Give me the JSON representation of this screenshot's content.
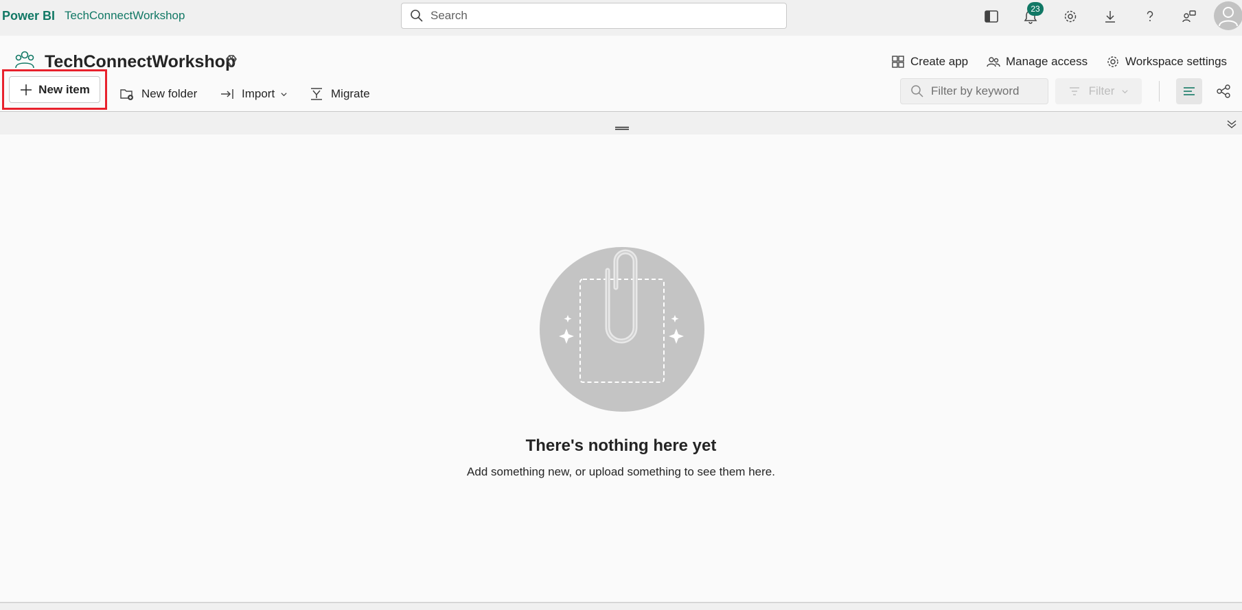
{
  "topbar": {
    "brand": "Power BI",
    "workspace_link": "TechConnectWorkshop",
    "search_placeholder": "Search",
    "notification_count": "23",
    "icons": [
      "panel-icon",
      "bell-icon",
      "gear-icon",
      "download-icon",
      "help-icon",
      "share-feedback-icon",
      "avatar-icon"
    ]
  },
  "workspace": {
    "title": "TechConnectWorkshop",
    "premium_icon": "diamond-icon",
    "actions": {
      "create_app": "Create app",
      "manage_access": "Manage access",
      "workspace_settings": "Workspace settings"
    }
  },
  "toolbar": {
    "new_item": "New item",
    "new_folder": "New folder",
    "import": "Import",
    "migrate": "Migrate",
    "filter_placeholder": "Filter by keyword",
    "filter": "Filter"
  },
  "empty_state": {
    "title": "There's nothing here yet",
    "subtitle": "Add something new, or upload something to see them here."
  },
  "colors": {
    "accent": "#117865",
    "highlight": "#e8212c"
  }
}
